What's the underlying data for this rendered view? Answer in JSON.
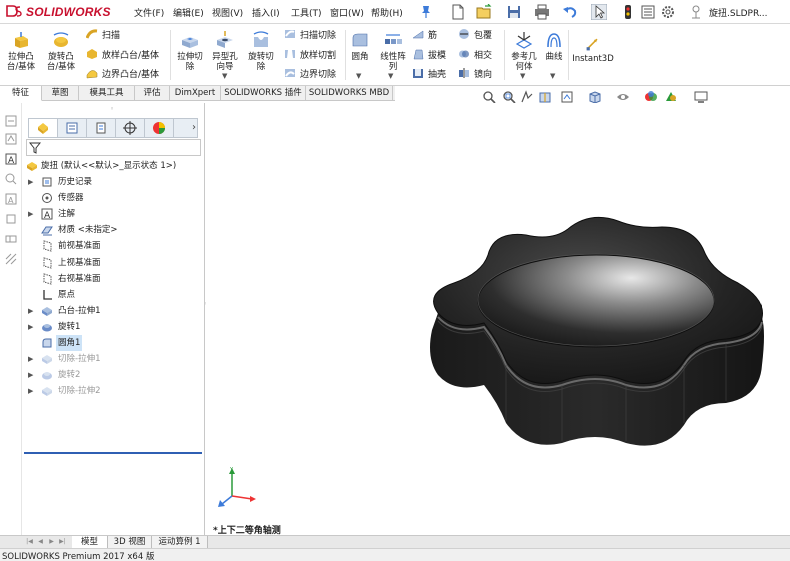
{
  "app": {
    "logo_text": "SOLIDWORKS",
    "document_title": "旋扭.SLDPR..."
  },
  "menu": [
    "文件(F)",
    "编辑(E)",
    "视图(V)",
    "插入(I)",
    "工具(T)",
    "窗口(W)",
    "帮助(H)"
  ],
  "ribbon": {
    "extrude_boss": "拉伸凸\n台/基体",
    "revolve_boss": "旋转凸\n台/基体",
    "sweep": "扫描",
    "loft_boss": "放样凸台/基体",
    "boundary_boss": "边界凸台/基体",
    "extrude_cut": "拉伸切\n除",
    "hole_wizard": "异型孔\n向导",
    "revolve_cut": "旋转切\n除",
    "sweep_cut": "扫描切除",
    "loft_cut": "放样切割",
    "boundary_cut": "边界切除",
    "fillet": "圆角",
    "linear_pattern": "线性阵\n列",
    "rib": "筋",
    "draft": "拔模",
    "shell": "抽壳",
    "wrap": "包覆",
    "intersect": "相交",
    "mirror": "镜向",
    "ref_geometry": "参考几\n何体",
    "curves": "曲线",
    "instant3d": "Instant3D"
  },
  "command_tabs": [
    "特征",
    "草图",
    "模具工具",
    "评估",
    "DimXpert",
    "SOLIDWORKS 插件",
    "SOLIDWORKS MBD"
  ],
  "feature_tree": {
    "root": "旋扭  (默认<<默认>_显示状态 1>)",
    "items": [
      {
        "label": "历史记录",
        "expandable": true,
        "suppressed": false
      },
      {
        "label": "传感器",
        "expandable": false,
        "suppressed": false
      },
      {
        "label": "注解",
        "expandable": true,
        "suppressed": false
      },
      {
        "label": "材质 <未指定>",
        "expandable": false,
        "suppressed": false
      },
      {
        "label": "前视基准面",
        "expandable": false,
        "suppressed": false
      },
      {
        "label": "上视基准面",
        "expandable": false,
        "suppressed": false
      },
      {
        "label": "右视基准面",
        "expandable": false,
        "suppressed": false
      },
      {
        "label": "原点",
        "expandable": false,
        "suppressed": false
      },
      {
        "label": "凸台-拉伸1",
        "expandable": true,
        "suppressed": false
      },
      {
        "label": "旋转1",
        "expandable": true,
        "suppressed": false
      },
      {
        "label": "圆角1",
        "expandable": false,
        "suppressed": false,
        "selected": true
      },
      {
        "label": "切除-拉伸1",
        "expandable": true,
        "suppressed": true
      },
      {
        "label": "旋转2",
        "expandable": true,
        "suppressed": true
      },
      {
        "label": "切除-拉伸2",
        "expandable": true,
        "suppressed": true
      }
    ]
  },
  "graphics": {
    "view_orientation": "*上下二等角轴测"
  },
  "bottom_tabs": [
    "模型",
    "3D 视图",
    "运动算例 1"
  ],
  "status_bar": "SOLIDWORKS Premium 2017 x64 版",
  "colors": {
    "brand_red": "#c8102e",
    "selection": "#cde3f7",
    "rollback_bar": "#2f5fb3",
    "model_body": "#1c1c1c"
  }
}
